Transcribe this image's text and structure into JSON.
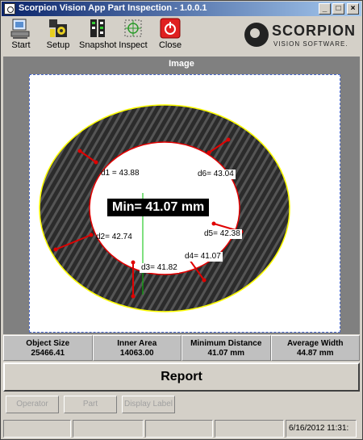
{
  "window": {
    "title": "Scorpion Vision App Part Inspection - 1.0.0.1"
  },
  "toolbar": {
    "buttons": [
      {
        "label": "Start",
        "icon": "start-icon"
      },
      {
        "label": "Setup",
        "icon": "setup-icon"
      },
      {
        "label": "Snapshot",
        "icon": "snapshot-icon"
      },
      {
        "label": "Inspect",
        "icon": "inspect-icon"
      },
      {
        "label": "Close",
        "icon": "power-icon"
      }
    ]
  },
  "logo": {
    "name": "SCORPION",
    "tagline": "VISION SOFTWARE."
  },
  "image_panel": {
    "header": "Image",
    "min_label": "Min= 41.07 mm",
    "measurements": {
      "d1": "d1 = 43.88",
      "d2": "d2= 42.74",
      "d3": "d3= 41.82",
      "d4": "d4= 41.07",
      "d5": "d5= 42.38",
      "d6": "d6= 43.04"
    }
  },
  "stats": [
    {
      "label": "Object Size",
      "value": "25466.41"
    },
    {
      "label": "Inner Area",
      "value": "14063.00"
    },
    {
      "label": "Minimum Distance",
      "value": "41.07 mm"
    },
    {
      "label": "Average Width",
      "value": "44.87 mm"
    }
  ],
  "report_button": "Report",
  "bottom_buttons": {
    "operator": "Operator",
    "part": "Part",
    "display_label": "Display Label"
  },
  "status_bar": {
    "datetime": "6/16/2012 11:31:"
  },
  "colors": {
    "title_start": "#0a246a",
    "title_end": "#a6caf0",
    "close_red": "#e02020",
    "measure_red": "#e00000",
    "contour_yellow": "#ffff00"
  }
}
